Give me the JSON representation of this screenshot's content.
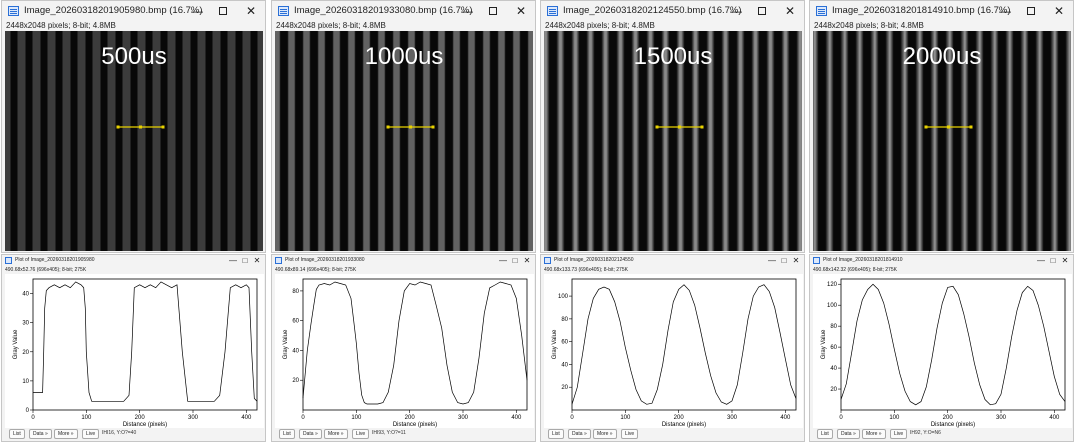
{
  "windows": [
    {
      "title": "Image_20260318201905980.bmp (16.7%)",
      "info": "2448x2048 pixels; 8-bit; 4.8MB",
      "label": "500us",
      "plot_title": "Plot of Image_20260318201905980",
      "plot_info": "490.68x52.76  (696x405); 8-bit; 275K",
      "coord": "IHI16, Y:O?=40",
      "stripe": {
        "period": 15,
        "duty": 0.55,
        "peak": 52,
        "edge": "sharp"
      },
      "chart_data": {
        "type": "line",
        "xlabel": "Distance (pixels)",
        "ylabel": "Gray Value",
        "xlim": [
          0,
          420
        ],
        "ylim": [
          0,
          45
        ],
        "xticks": [
          0,
          100,
          200,
          300,
          400
        ],
        "yticks": [
          0,
          10,
          20,
          30,
          40
        ],
        "x": [
          0,
          10,
          18,
          20,
          22,
          25,
          30,
          40,
          50,
          60,
          70,
          80,
          90,
          95,
          98,
          100,
          105,
          110,
          120,
          130,
          140,
          150,
          160,
          170,
          180,
          185,
          190,
          200,
          210,
          220,
          230,
          240,
          250,
          260,
          270,
          280,
          290,
          300,
          310,
          315,
          320,
          330,
          340,
          350,
          360,
          370,
          380,
          390,
          400,
          405,
          410,
          415,
          420
        ],
        "y": [
          6,
          6,
          6,
          20,
          35,
          41,
          42,
          43,
          42,
          43,
          42,
          44,
          43,
          42,
          35,
          20,
          6,
          3,
          3,
          3,
          3,
          3,
          3,
          3,
          5,
          20,
          42,
          43,
          42,
          43,
          42,
          44,
          43,
          42,
          43,
          20,
          3,
          3,
          3,
          3,
          3,
          3,
          3,
          5,
          20,
          42,
          43,
          42,
          43,
          42,
          20,
          4,
          3
        ]
      }
    },
    {
      "title": "Image_20260318201933080.bmp (16.7%)",
      "info": "2448x2048 pixels; 8-bit; 4.8MB",
      "label": "1000us",
      "plot_title": "Plot of Image_20260318201933080",
      "plot_info": "490.68x89.14  (696x405); 8-bit; 275K",
      "coord": "IHI93, Y:O?=11",
      "stripe": {
        "period": 15,
        "duty": 0.55,
        "peak": 90,
        "edge": "medium"
      },
      "chart_data": {
        "type": "line",
        "xlabel": "Distance (pixels)",
        "ylabel": "Gray Value",
        "xlim": [
          0,
          420
        ],
        "ylim": [
          0,
          88
        ],
        "xticks": [
          0,
          100,
          200,
          300,
          400
        ],
        "yticks": [
          20,
          40,
          60,
          80
        ],
        "x": [
          0,
          8,
          15,
          20,
          25,
          30,
          40,
          50,
          60,
          70,
          80,
          90,
          95,
          100,
          105,
          110,
          115,
          120,
          130,
          140,
          150,
          160,
          170,
          180,
          190,
          200,
          210,
          220,
          230,
          240,
          250,
          260,
          270,
          280,
          290,
          300,
          310,
          320,
          330,
          340,
          350,
          360,
          370,
          380,
          390,
          400,
          410,
          420
        ],
        "y": [
          8,
          40,
          58,
          70,
          81,
          84,
          85,
          84,
          86,
          85,
          84,
          75,
          60,
          45,
          25,
          10,
          5,
          4,
          4,
          4,
          5,
          12,
          30,
          60,
          80,
          85,
          84,
          86,
          85,
          84,
          70,
          55,
          30,
          12,
          5,
          4,
          5,
          12,
          35,
          65,
          82,
          84,
          86,
          85,
          84,
          75,
          50,
          20
        ]
      }
    },
    {
      "title": "Image_20260318202124550.bmp (16.7%)",
      "info": "2448x2048 pixels; 8-bit; 4.8MB",
      "label": "1500us",
      "plot_title": "Plot of Image_20260318202124550",
      "plot_info": "490.68x133.73  (696x405); 8-bit; 275K",
      "coord": "",
      "stripe": {
        "period": 15,
        "duty": 0.55,
        "peak": 130,
        "edge": "soft"
      },
      "chart_data": {
        "type": "line",
        "xlabel": "Distance (pixels)",
        "ylabel": "Gray Value",
        "xlim": [
          0,
          420
        ],
        "ylim": [
          0,
          115
        ],
        "xticks": [
          0,
          100,
          200,
          300,
          400
        ],
        "yticks": [
          20,
          40,
          60,
          80,
          100
        ],
        "x": [
          0,
          10,
          20,
          30,
          40,
          50,
          60,
          70,
          80,
          90,
          100,
          110,
          120,
          130,
          140,
          150,
          160,
          170,
          180,
          190,
          200,
          210,
          220,
          230,
          240,
          250,
          260,
          270,
          280,
          290,
          300,
          310,
          320,
          330,
          340,
          350,
          360,
          370,
          380,
          390,
          400,
          410,
          420
        ],
        "y": [
          5,
          20,
          50,
          80,
          98,
          106,
          108,
          106,
          95,
          78,
          55,
          35,
          18,
          8,
          5,
          6,
          18,
          40,
          70,
          95,
          106,
          110,
          105,
          92,
          72,
          50,
          30,
          15,
          7,
          5,
          8,
          22,
          50,
          80,
          100,
          108,
          110,
          104,
          90,
          68,
          45,
          22,
          10
        ]
      }
    },
    {
      "title": "Image_20260318201814910.bmp (16.7%)",
      "info": "2448x2048 pixels; 8-bit; 4.8MB",
      "label": "2000us",
      "plot_title": "Plot of Image_20260318201814910",
      "plot_info": "490.68x142.32  (696x405); 8-bit; 275K",
      "coord": "IH92, Y:O=N6",
      "stripe": {
        "period": 15,
        "duty": 0.55,
        "peak": 145,
        "edge": "softer"
      },
      "chart_data": {
        "type": "line",
        "xlabel": "Distance (pixels)",
        "ylabel": "Gray Value",
        "xlim": [
          0,
          420
        ],
        "ylim": [
          0,
          125
        ],
        "xticks": [
          0,
          100,
          200,
          300,
          400
        ],
        "yticks": [
          20,
          40,
          60,
          80,
          100,
          120
        ],
        "x": [
          0,
          10,
          20,
          30,
          40,
          50,
          60,
          70,
          80,
          90,
          100,
          110,
          120,
          130,
          140,
          150,
          160,
          170,
          180,
          190,
          200,
          210,
          220,
          230,
          240,
          250,
          260,
          270,
          280,
          290,
          300,
          310,
          320,
          330,
          340,
          350,
          360,
          370,
          380,
          390,
          400,
          410,
          420
        ],
        "y": [
          10,
          25,
          55,
          85,
          105,
          115,
          120,
          115,
          102,
          82,
          58,
          35,
          18,
          8,
          5,
          8,
          22,
          48,
          78,
          102,
          117,
          118,
          110,
          92,
          70,
          45,
          24,
          10,
          5,
          6,
          15,
          40,
          70,
          95,
          112,
          118,
          114,
          100,
          80,
          56,
          32,
          15,
          8
        ]
      }
    }
  ],
  "buttons": {
    "list": "List",
    "data": "Data »",
    "more": "More »",
    "live": "Live"
  },
  "window_controls": {
    "minimize": "—",
    "maximize": "□",
    "close": "✕"
  }
}
